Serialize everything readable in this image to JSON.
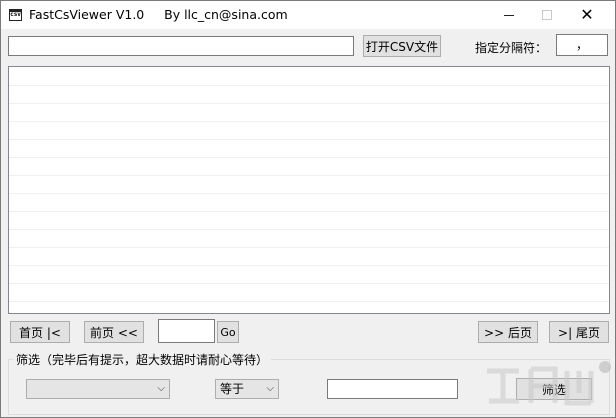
{
  "window": {
    "title": "FastCsViewer V1.0     By llc_cn@sina.com",
    "icon": "csv-app-icon",
    "controls": {
      "minimize": "minimize",
      "maximize": "maximize",
      "close": "✕"
    }
  },
  "toolbar": {
    "path_value": "",
    "open_button": "打开CSV文件",
    "separator_label": "指定分隔符：",
    "separator_value": "，"
  },
  "grid": {
    "rows": []
  },
  "pagination": {
    "first_button": "首页 |<",
    "prev_button": "前页 <<",
    "page_value": "",
    "go_button": "Go",
    "next_button": ">> 后页",
    "last_button": ">| 尾页"
  },
  "filter": {
    "legend": "筛选（完毕后有提示，超大数据时请耐心等待）",
    "field_value": "",
    "operator_value": "等于",
    "value": "",
    "button": "筛选"
  },
  "colors": {
    "window_bg": "#f0f0f0",
    "button_bg": "#e1e1e1",
    "border": "#adadad"
  }
}
